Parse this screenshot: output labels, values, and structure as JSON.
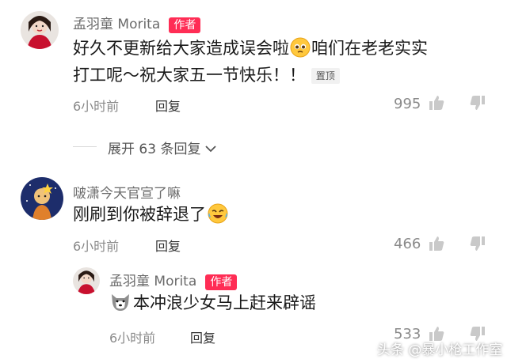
{
  "comments": [
    {
      "author": "孟羽童 Morita",
      "badge": "作者",
      "text_line1": "好久不更新给大家造成误会啦",
      "text_line1b": "咱们在老老实实",
      "text_line2": "打工呢～祝大家五一节快乐！！",
      "pin": "置顶",
      "time": "6小时前",
      "reply_label": "回复",
      "likes": "995"
    },
    {
      "author": "啵潇今天官宣了嘛",
      "text": "刚刷到你被辞退了",
      "time": "6小时前",
      "reply_label": "回复",
      "likes": "466"
    },
    {
      "author": "孟羽童 Morita",
      "badge": "作者",
      "text": "本冲浪少女马上赶来辟谣",
      "time": "6小时前",
      "reply_label": "回复",
      "likes": "533"
    }
  ],
  "expand_label": "展开 63 条回复",
  "watermark": "头条 @暴小枪工作室",
  "colors": {
    "badge": "#ff2d55",
    "meta": "#8a8a8a"
  },
  "icons": [
    "thumbs-up-icon",
    "thumbs-down-icon",
    "chevron-down-icon",
    "emoji-pleading-icon",
    "emoji-laugh-cry-icon",
    "emoji-dog-icon"
  ]
}
